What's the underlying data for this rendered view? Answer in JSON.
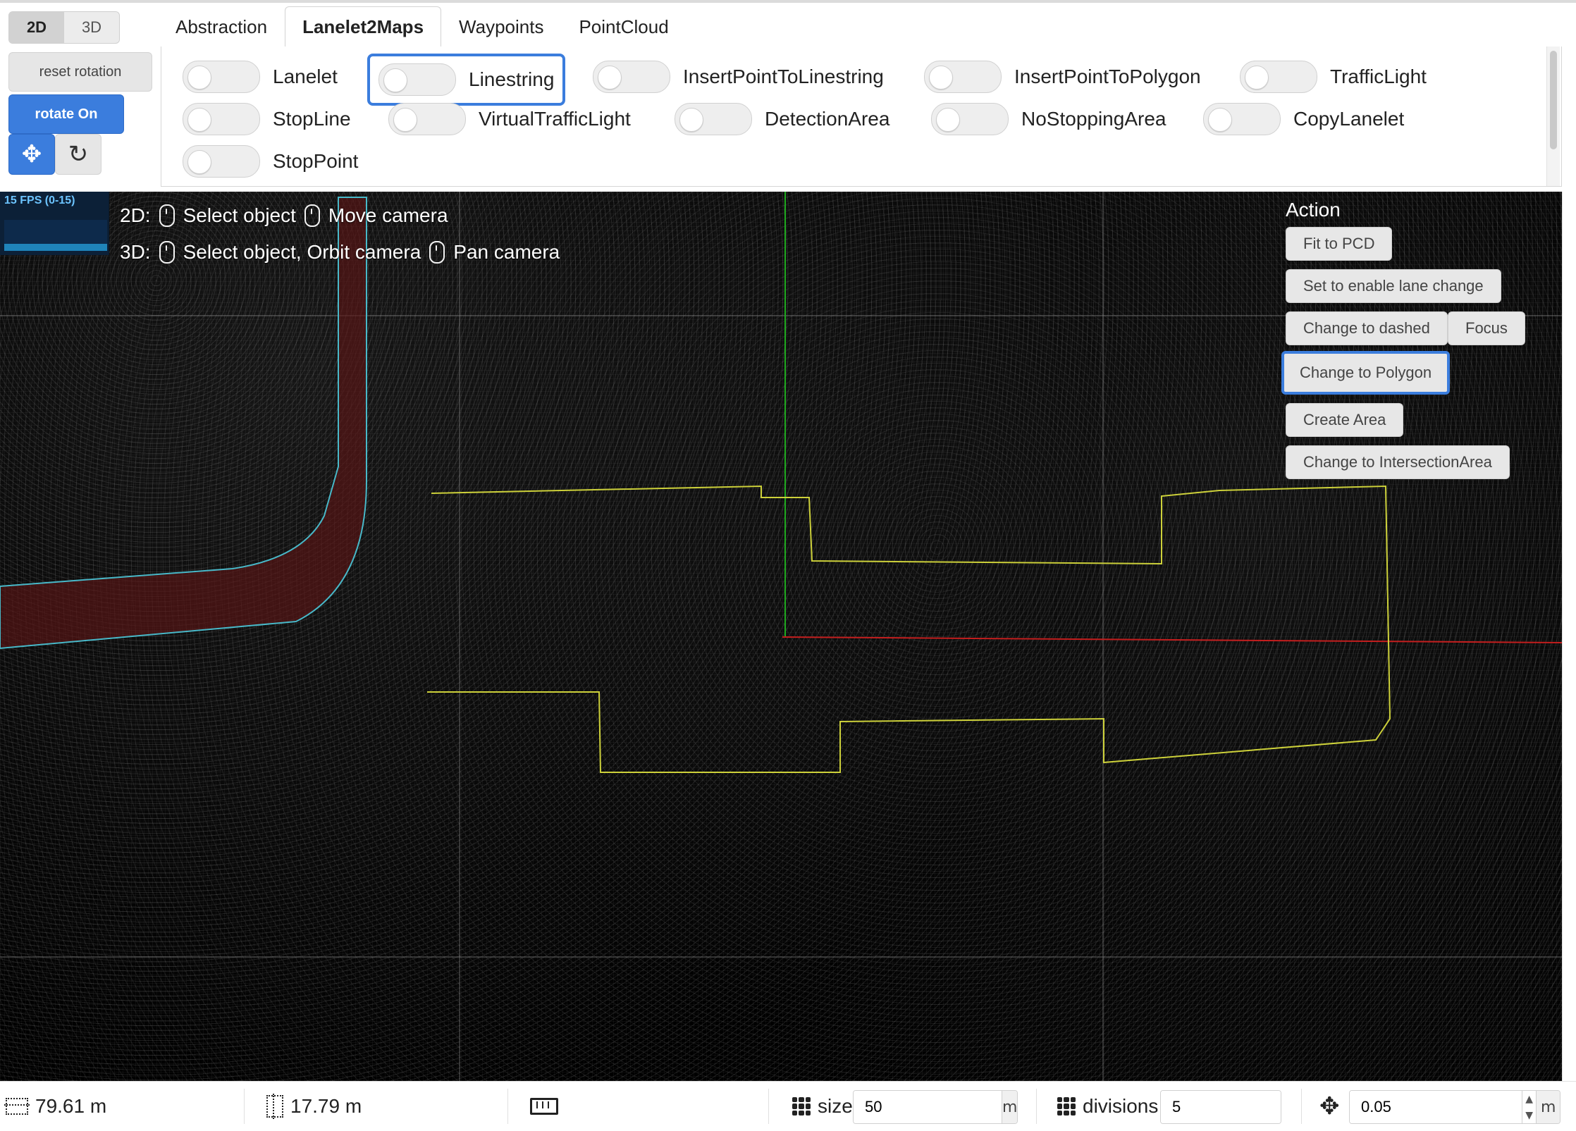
{
  "mode": {
    "active": "2D",
    "inactive": "3D"
  },
  "controls": {
    "reset_rotation": "reset rotation",
    "rotate_on": "rotate On",
    "move_icon": "✥",
    "refresh_icon": "↻"
  },
  "tabs": [
    {
      "label": "Abstraction"
    },
    {
      "label": "Lanelet2Maps"
    },
    {
      "label": "Waypoints"
    },
    {
      "label": "PointCloud"
    }
  ],
  "options": {
    "row1": [
      {
        "label": "Lanelet"
      },
      {
        "label": "Linestring"
      },
      {
        "label": "InsertPointToLinestring"
      },
      {
        "label": "InsertPointToPolygon"
      },
      {
        "label": "TrafficLight"
      }
    ],
    "row2": [
      {
        "label": "StopLine"
      },
      {
        "label": "VirtualTrafficLight"
      },
      {
        "label": "DetectionArea"
      },
      {
        "label": "NoStoppingArea"
      },
      {
        "label": "CopyLanelet"
      }
    ],
    "row3": [
      {
        "label": "StopPoint"
      }
    ]
  },
  "viewport": {
    "fps": "15 FPS (0-15)",
    "help": {
      "l1_prefix": "2D:",
      "l1_a": "Select object",
      "l1_b": "Move camera",
      "l2_prefix": "3D:",
      "l2_a": "Select object, Orbit camera",
      "l2_b": "Pan camera"
    },
    "action": {
      "title": "Action",
      "buttons": [
        "Fit to PCD",
        "Set to enable lane change",
        "Change to dashed",
        "Focus",
        "Change to Polygon",
        "Create Area",
        "Change to IntersectionArea"
      ]
    }
  },
  "bottom": {
    "width_value": "79.61 m",
    "height_value": "17.79 m",
    "size_label": "size",
    "size_value": "50",
    "size_unit": "m",
    "divisions_label": "divisions",
    "divisions_value": "5",
    "move_value": "0.05",
    "move_unit": "m"
  },
  "colors": {
    "accent": "#3b7ddd",
    "grid_line": "#8a8a8a",
    "axis_green": "#1faa1f",
    "axis_red": "#c41e1e",
    "polygon_yellow": "#cdd13a",
    "lane_cyan": "#48b9c9",
    "lane_red": "#5b1616"
  }
}
